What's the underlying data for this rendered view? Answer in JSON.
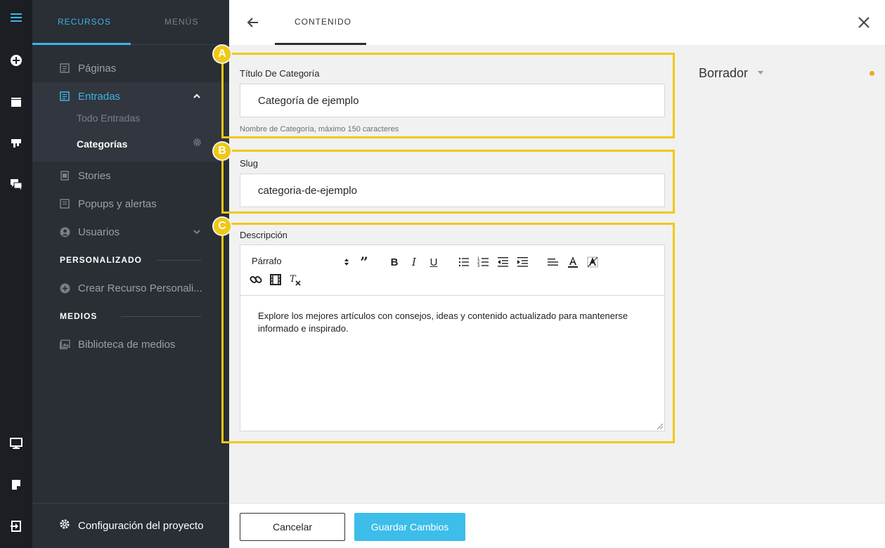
{
  "rail": {
    "icons": [
      "menu-icon",
      "add-circle-icon",
      "window-icon",
      "puzzle-icon",
      "chat-icon",
      "monitor-icon",
      "note-icon",
      "logout-icon"
    ]
  },
  "sidebar": {
    "tabs": [
      {
        "label": "RECURSOS",
        "active": true
      },
      {
        "label": "MENÚS",
        "active": false
      }
    ],
    "items": {
      "paginas": "Páginas",
      "entradas": "Entradas",
      "todo_entradas": "Todo Entradas",
      "categorias": "Categorías",
      "stories": "Stories",
      "popups": "Popups y alertas",
      "usuarios": "Usuarios"
    },
    "sections": {
      "personalizado": "PERSONALIZADO",
      "crear_recurso": "Crear Recurso Personali...",
      "medios": "MEDIOS",
      "biblioteca": "Biblioteca de medios"
    },
    "config": "Configuración del proyecto"
  },
  "topbar": {
    "tab": "CONTENIDO"
  },
  "form": {
    "markers": [
      "A",
      "B",
      "C"
    ],
    "title_label": "Título De Categoría",
    "title_value": "Categoría de ejemplo",
    "title_help": "Nombre de Categoría, máximo 150 caracteres",
    "slug_label": "Slug",
    "slug_value": "categoria-de-ejemplo",
    "desc_label": "Descripción",
    "editor": {
      "format": "Párrafo",
      "text": "Explore los mejores artículos con consejos, ideas y contenido actualizado para mantenerse informado e inspirado."
    }
  },
  "status": {
    "label": "Borrador",
    "dot_color": "#e8a92b"
  },
  "footer": {
    "cancel": "Cancelar",
    "save": "Guardar Cambios"
  },
  "colors": {
    "accent": "#3cb4e7",
    "highlight": "#f0c814",
    "sidebar_bg": "#2a2e35",
    "rail_bg": "#1b1e23"
  }
}
